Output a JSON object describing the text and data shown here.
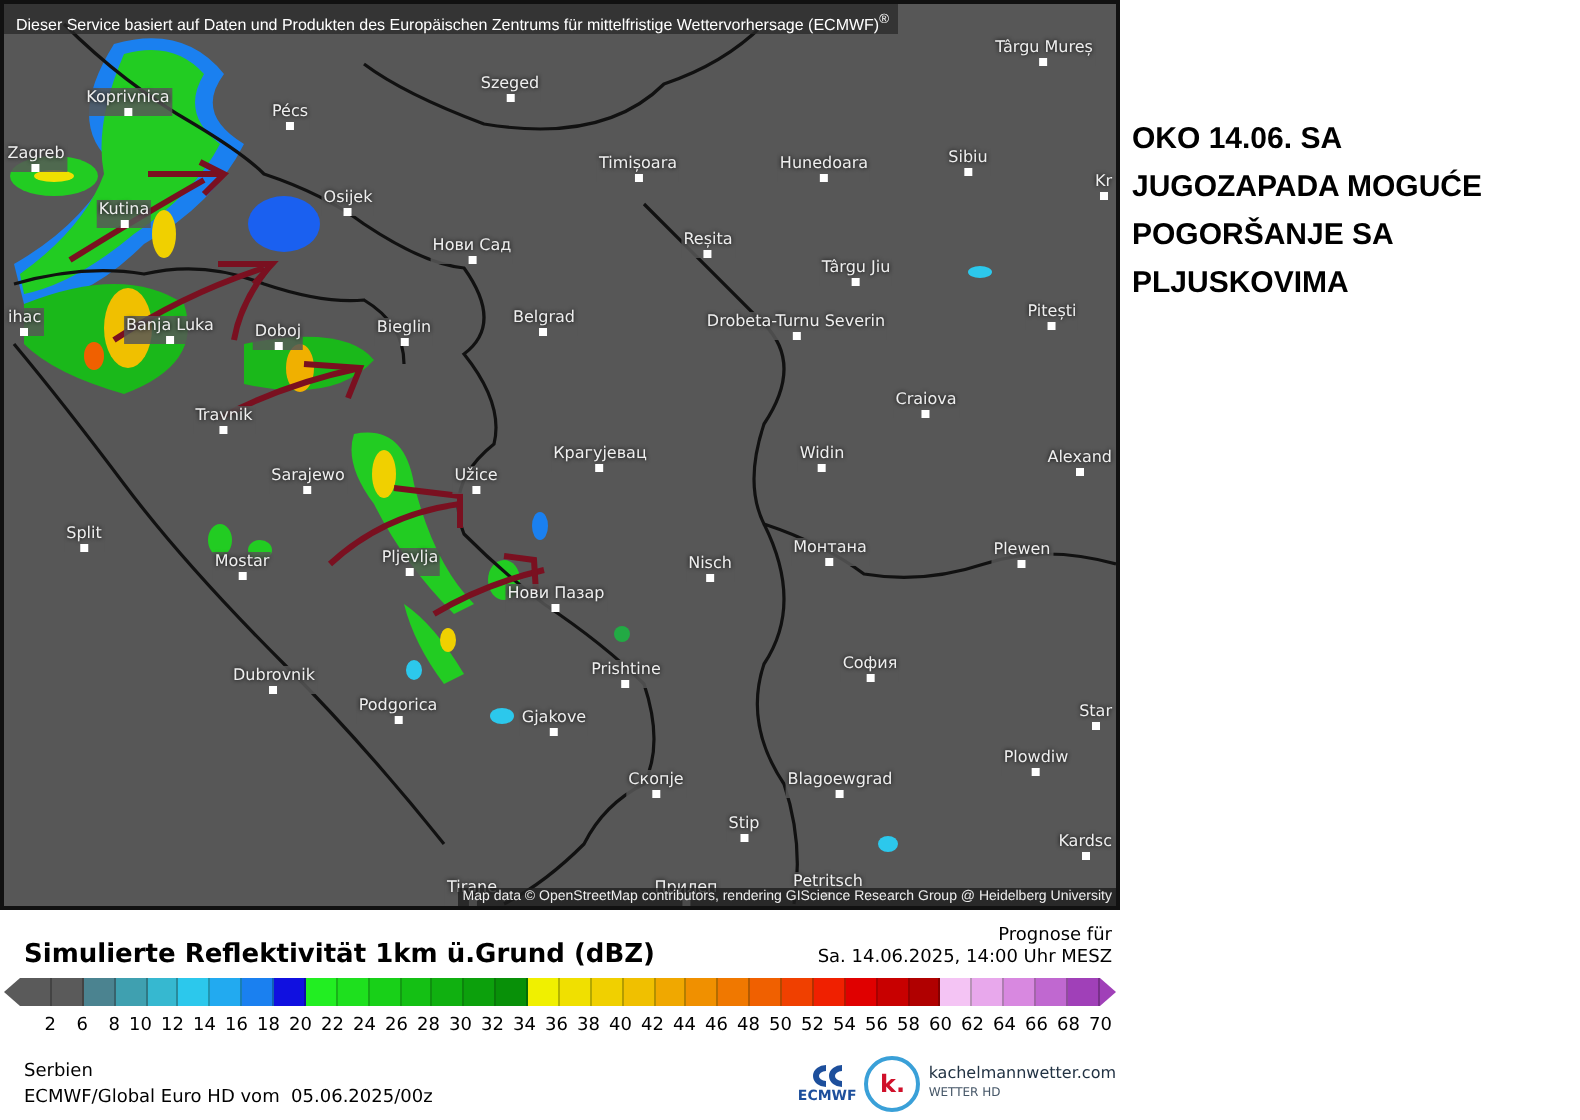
{
  "map": {
    "header": "Dieser Service basiert auf Daten und Produkten des Europäischen Zentrums für mittelfristige Wettervorhersage (ECMWF)$^{®}$",
    "cities": [
      "Târgu Mureș",
      "Szeged",
      "Koprivnica",
      "Pécs",
      "Zagreb",
      "Timișoara",
      "Hunedoara",
      "Sibiu",
      "Kr",
      "Osijek",
      "Kutina",
      "Reșita",
      "Нови Сад",
      "Târgu Jiu",
      "ihac",
      "Banja Luka",
      "Doboj",
      "Bieglin",
      "Belgrad",
      "Drobeta-Turnu Severin",
      "Pitești",
      "Craiova",
      "Travnik",
      "Крагујевац",
      "Widin",
      "Alexand",
      "Sarajewo",
      "Užice",
      "Split",
      "Mostar",
      "Pljevlja",
      "Nisch",
      "Монтана",
      "Plewen",
      "Нови Пазар",
      "Prishtine",
      "Dubrovnik",
      "София",
      "Podgorica",
      "Gjakove",
      "Star",
      "Plowdiw",
      "Скопје",
      "Blagoewgrad",
      "Stip",
      "Kardsc",
      "Petritsch",
      "Tirane",
      "Прилеп"
    ],
    "attribution": "Map data © OpenStreetMap contributors, rendering GIScience Research Group @ Heidelberg University"
  },
  "annotation": "OKO 14.06. SA JUGOZAPADA MOGUĆE POGORŠANJE SA PLJUSKOVIMA",
  "legend": {
    "title": "Simulierte Reflektivität 1km ü.Grund (dBZ)",
    "forecast_label": "Prognose für",
    "forecast_time": "Sa. 14.06.2025, 14:00 Uhr MESZ",
    "bins": [
      {
        "color": "#5a5a5a"
      },
      {
        "color": "#5a5a5a"
      },
      {
        "color": "#4b8390"
      },
      {
        "color": "#3fa0b0"
      },
      {
        "color": "#36b8d0"
      },
      {
        "color": "#2cc8ec"
      },
      {
        "color": "#22aaf0"
      },
      {
        "color": "#1a80f0"
      },
      {
        "color": "#1010e0"
      },
      {
        "color": "#22ee22"
      },
      {
        "color": "#1ee01e"
      },
      {
        "color": "#18d018"
      },
      {
        "color": "#14c014"
      },
      {
        "color": "#10b010"
      },
      {
        "color": "#0ca00c"
      },
      {
        "color": "#089008"
      },
      {
        "color": "#f0f000"
      },
      {
        "color": "#f0e000"
      },
      {
        "color": "#f0d000"
      },
      {
        "color": "#f0c000"
      },
      {
        "color": "#f0a800"
      },
      {
        "color": "#f09000"
      },
      {
        "color": "#f07800"
      },
      {
        "color": "#f06000"
      },
      {
        "color": "#f04000"
      },
      {
        "color": "#f02000"
      },
      {
        "color": "#e00000"
      },
      {
        "color": "#c80000"
      },
      {
        "color": "#b00000"
      },
      {
        "color": "#f4c4f4"
      },
      {
        "color": "#e8a8ec"
      },
      {
        "color": "#d888e0"
      },
      {
        "color": "#c068d0"
      },
      {
        "color": "#a040b8"
      }
    ],
    "ticks": [
      "2",
      "6",
      "8",
      "10",
      "12",
      "14",
      "16",
      "18",
      "20",
      "22",
      "24",
      "26",
      "28",
      "30",
      "32",
      "34",
      "36",
      "38",
      "40",
      "42",
      "44",
      "46",
      "48",
      "50",
      "52",
      "54",
      "56",
      "58",
      "60",
      "62",
      "64",
      "66",
      "68",
      "70"
    ]
  },
  "footer": {
    "region": "Serbien",
    "model_run": "ECMWF/Global Euro HD vom  05.06.2025/00z",
    "ecmwf_logo": "ECMWF",
    "brand_mark": "k.",
    "brand": "kachelmannwetter.com",
    "brand_sub": "WETTER HD"
  }
}
